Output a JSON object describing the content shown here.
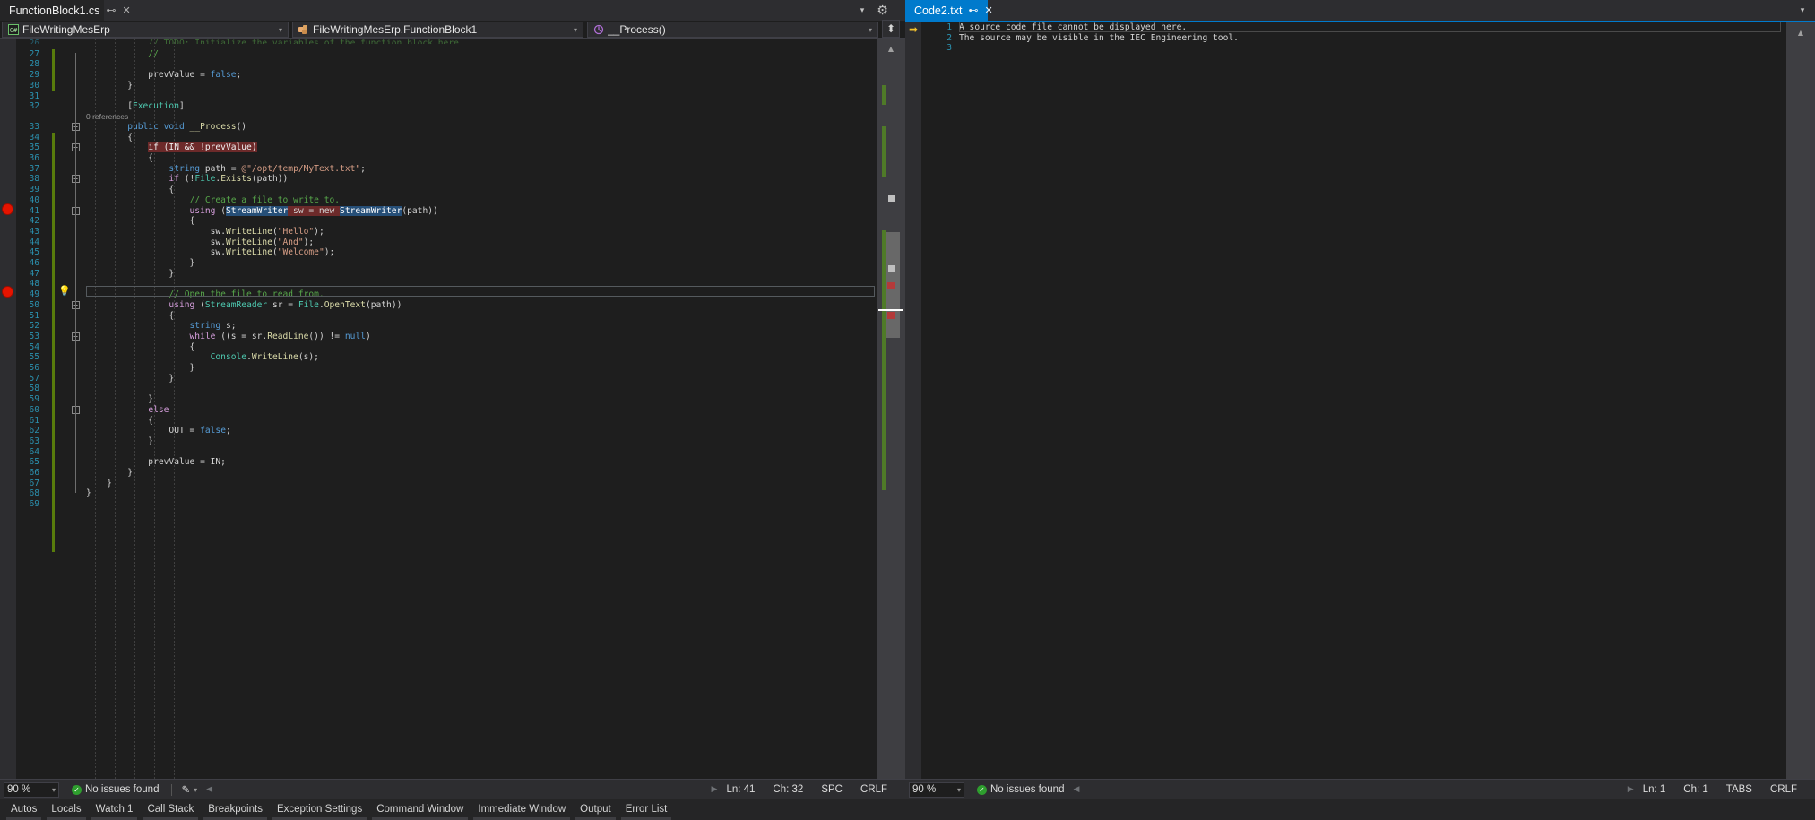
{
  "window": {
    "background": "#1e1e1e",
    "accent": "#007acc"
  },
  "left_pane": {
    "tab": {
      "label": "FunctionBlock1.cs",
      "pin_icon": "pin-icon",
      "close_icon": "close-icon",
      "pin_glyph": "⊷",
      "close_glyph": "✕"
    },
    "gear_glyph": "⚙",
    "chevron_glyph": "▾",
    "navbar": {
      "project_combo": {
        "icon": "csharp-file-icon",
        "value": "FileWritingMesErp",
        "arrow": "▾"
      },
      "type_combo": {
        "icon": "class-icon",
        "value": "FileWritingMesErp.FunctionBlock1",
        "arrow": "▾"
      },
      "member_combo": {
        "icon": "method-icon",
        "value": "__Process()",
        "arrow": "▾"
      },
      "split_button": {
        "icon": "split-window-icon",
        "glyph": "⬍"
      }
    },
    "editor": {
      "first_visible_line": 26,
      "current_line": 41,
      "breakpoint_lines": [
        35,
        41
      ],
      "lightbulb_line": 41,
      "lines": [
        {
          "n": 26,
          "clipped": true,
          "tokens": [
            {
              "t": "            // TODO: Initialize the variables of the function block here",
              "c": "cmt"
            }
          ]
        },
        {
          "n": 27,
          "tokens": [
            {
              "t": "            //",
              "c": "cmt"
            }
          ]
        },
        {
          "n": 28,
          "tokens": []
        },
        {
          "n": 29,
          "tokens": [
            {
              "t": "            prevValue ",
              "c": "id"
            },
            {
              "t": "= ",
              "c": "pun"
            },
            {
              "t": "false",
              "c": "kw"
            },
            {
              "t": ";",
              "c": "pun"
            }
          ]
        },
        {
          "n": 30,
          "tokens": [
            {
              "t": "        }",
              "c": "pun"
            }
          ]
        },
        {
          "n": 31,
          "tokens": []
        },
        {
          "n": 32,
          "tokens": [
            {
              "t": "        [",
              "c": "pun"
            },
            {
              "t": "Execution",
              "c": "attr"
            },
            {
              "t": "]",
              "c": "pun"
            }
          ]
        },
        {
          "n": 33,
          "refs": "0 references",
          "tokens": [
            {
              "t": "        ",
              "c": "pun"
            },
            {
              "t": "public ",
              "c": "kw"
            },
            {
              "t": "void ",
              "c": "kw"
            },
            {
              "t": "__Process",
              "c": "mth"
            },
            {
              "t": "()",
              "c": "pun"
            }
          ]
        },
        {
          "n": 34,
          "tokens": [
            {
              "t": "        {",
              "c": "pun"
            }
          ]
        },
        {
          "n": 35,
          "highlight": "breakpoint",
          "tokens": [
            {
              "t": "            ",
              "c": "pun"
            },
            {
              "t": "if (IN && !prevValue)",
              "c": "hl-bp"
            }
          ]
        },
        {
          "n": 36,
          "tokens": [
            {
              "t": "            {",
              "c": "pun"
            }
          ]
        },
        {
          "n": 37,
          "tokens": [
            {
              "t": "                ",
              "c": "pun"
            },
            {
              "t": "string ",
              "c": "kw"
            },
            {
              "t": "path ",
              "c": "id"
            },
            {
              "t": "= ",
              "c": "pun"
            },
            {
              "t": "@\"/opt/temp/MyText.txt\"",
              "c": "str"
            },
            {
              "t": ";",
              "c": "pun"
            }
          ]
        },
        {
          "n": 38,
          "tokens": [
            {
              "t": "                ",
              "c": "pun"
            },
            {
              "t": "if ",
              "c": "kwc"
            },
            {
              "t": "(!",
              "c": "pun"
            },
            {
              "t": "File",
              "c": "typ"
            },
            {
              "t": ".",
              "c": "pun"
            },
            {
              "t": "Exists",
              "c": "mth"
            },
            {
              "t": "(path))",
              "c": "pun"
            }
          ]
        },
        {
          "n": 39,
          "tokens": [
            {
              "t": "                {",
              "c": "pun"
            }
          ]
        },
        {
          "n": 40,
          "tokens": [
            {
              "t": "                    // Create a file to write to.",
              "c": "cmt"
            }
          ]
        },
        {
          "n": 41,
          "highlight": "current",
          "tokens": [
            {
              "t": "                    ",
              "c": "pun"
            },
            {
              "t": "using ",
              "c": "kwc"
            },
            {
              "t": "(",
              "c": "pun"
            },
            {
              "t": "StreamWriter",
              "c": "hl-sel"
            },
            {
              "t": " sw = new ",
              "c": "hl-word"
            },
            {
              "t": "StreamWriter",
              "c": "hl-sel"
            },
            {
              "t": "(path))",
              "c": "pun"
            }
          ]
        },
        {
          "n": 42,
          "tokens": [
            {
              "t": "                    {",
              "c": "pun"
            }
          ]
        },
        {
          "n": 43,
          "tokens": [
            {
              "t": "                        sw",
              "c": "id"
            },
            {
              "t": ".",
              "c": "pun"
            },
            {
              "t": "WriteLine",
              "c": "mth"
            },
            {
              "t": "(",
              "c": "pun"
            },
            {
              "t": "\"Hello\"",
              "c": "str"
            },
            {
              "t": ");",
              "c": "pun"
            }
          ]
        },
        {
          "n": 44,
          "tokens": [
            {
              "t": "                        sw",
              "c": "id"
            },
            {
              "t": ".",
              "c": "pun"
            },
            {
              "t": "WriteLine",
              "c": "mth"
            },
            {
              "t": "(",
              "c": "pun"
            },
            {
              "t": "\"And\"",
              "c": "str"
            },
            {
              "t": ");",
              "c": "pun"
            }
          ]
        },
        {
          "n": 45,
          "tokens": [
            {
              "t": "                        sw",
              "c": "id"
            },
            {
              "t": ".",
              "c": "pun"
            },
            {
              "t": "WriteLine",
              "c": "mth"
            },
            {
              "t": "(",
              "c": "pun"
            },
            {
              "t": "\"Welcome\"",
              "c": "str"
            },
            {
              "t": ");",
              "c": "pun"
            }
          ]
        },
        {
          "n": 46,
          "tokens": [
            {
              "t": "                    }",
              "c": "pun"
            }
          ]
        },
        {
          "n": 47,
          "tokens": [
            {
              "t": "                }",
              "c": "pun"
            }
          ]
        },
        {
          "n": 48,
          "tokens": []
        },
        {
          "n": 49,
          "tokens": [
            {
              "t": "                // Open the file to read from.",
              "c": "cmt"
            }
          ]
        },
        {
          "n": 50,
          "tokens": [
            {
              "t": "                ",
              "c": "pun"
            },
            {
              "t": "using ",
              "c": "kwc"
            },
            {
              "t": "(",
              "c": "pun"
            },
            {
              "t": "StreamReader",
              "c": "typ"
            },
            {
              "t": " sr = ",
              "c": "id"
            },
            {
              "t": "File",
              "c": "typ"
            },
            {
              "t": ".",
              "c": "pun"
            },
            {
              "t": "OpenText",
              "c": "mth"
            },
            {
              "t": "(path))",
              "c": "pun"
            }
          ]
        },
        {
          "n": 51,
          "tokens": [
            {
              "t": "                {",
              "c": "pun"
            }
          ]
        },
        {
          "n": 52,
          "tokens": [
            {
              "t": "                    ",
              "c": "pun"
            },
            {
              "t": "string ",
              "c": "kw"
            },
            {
              "t": "s",
              "c": "id"
            },
            {
              "t": ";",
              "c": "pun"
            }
          ]
        },
        {
          "n": 53,
          "tokens": [
            {
              "t": "                    ",
              "c": "pun"
            },
            {
              "t": "while ",
              "c": "kwc"
            },
            {
              "t": "((s = sr",
              "c": "id"
            },
            {
              "t": ".",
              "c": "pun"
            },
            {
              "t": "ReadLine",
              "c": "mth"
            },
            {
              "t": "()) != ",
              "c": "pun"
            },
            {
              "t": "null",
              "c": "kw"
            },
            {
              "t": ")",
              "c": "pun"
            }
          ]
        },
        {
          "n": 54,
          "tokens": [
            {
              "t": "                    {",
              "c": "pun"
            }
          ]
        },
        {
          "n": 55,
          "tokens": [
            {
              "t": "                        ",
              "c": "pun"
            },
            {
              "t": "Console",
              "c": "typ"
            },
            {
              "t": ".",
              "c": "pun"
            },
            {
              "t": "WriteLine",
              "c": "mth"
            },
            {
              "t": "(s);",
              "c": "pun"
            }
          ]
        },
        {
          "n": 56,
          "tokens": [
            {
              "t": "                    }",
              "c": "pun"
            }
          ]
        },
        {
          "n": 57,
          "tokens": [
            {
              "t": "                }",
              "c": "pun"
            }
          ]
        },
        {
          "n": 58,
          "tokens": []
        },
        {
          "n": 59,
          "tokens": [
            {
              "t": "            }",
              "c": "pun"
            }
          ]
        },
        {
          "n": 60,
          "tokens": [
            {
              "t": "            ",
              "c": "pun"
            },
            {
              "t": "else",
              "c": "kwc"
            }
          ]
        },
        {
          "n": 61,
          "tokens": [
            {
              "t": "            {",
              "c": "pun"
            }
          ]
        },
        {
          "n": 62,
          "tokens": [
            {
              "t": "                OUT ",
              "c": "id"
            },
            {
              "t": "= ",
              "c": "pun"
            },
            {
              "t": "false",
              "c": "kw"
            },
            {
              "t": ";",
              "c": "pun"
            }
          ]
        },
        {
          "n": 63,
          "tokens": [
            {
              "t": "            }",
              "c": "pun"
            }
          ]
        },
        {
          "n": 64,
          "tokens": []
        },
        {
          "n": 65,
          "tokens": [
            {
              "t": "            prevValue ",
              "c": "id"
            },
            {
              "t": "= IN;",
              "c": "pun"
            }
          ]
        },
        {
          "n": 66,
          "tokens": [
            {
              "t": "        }",
              "c": "pun"
            }
          ]
        },
        {
          "n": 67,
          "tokens": [
            {
              "t": "    }",
              "c": "pun"
            }
          ]
        },
        {
          "n": 68,
          "tokens": [
            {
              "t": "}",
              "c": "pun"
            }
          ]
        },
        {
          "n": 69,
          "tokens": []
        }
      ]
    },
    "statusbar": {
      "zoom": "90 %",
      "zoom_arrow": "▾",
      "issues_icon": "check-circle-icon",
      "issues": "No issues found",
      "pen_icon": "pen-icon",
      "pen_glyph": "✎",
      "pen_arrow": "▾",
      "scroll_left_glyph": "◀",
      "scroll_right_glyph": "▶",
      "line": "Ln: 41",
      "col": "Ch: 32",
      "indent": "SPC",
      "eol": "CRLF"
    }
  },
  "right_pane": {
    "tab": {
      "label": "Code2.txt",
      "active": true,
      "pin_glyph": "⊷",
      "close_glyph": "✕"
    },
    "gear_glyph": "▾",
    "editor": {
      "marker_line": 1,
      "marker_icon": "bookmark-arrow-icon",
      "marker_glyph": "➡",
      "lines": [
        {
          "n": 1,
          "text": "A source code file cannot be displayed here."
        },
        {
          "n": 2,
          "text": "The source may be visible in the IEC Engineering tool."
        },
        {
          "n": 3,
          "text": ""
        }
      ]
    },
    "statusbar": {
      "zoom": "90 %",
      "zoom_arrow": "▾",
      "issues_icon": "check-circle-icon",
      "issues": "No issues found",
      "scroll_left_glyph": "◀",
      "scroll_right_glyph": "▶",
      "line": "Ln: 1",
      "col": "Ch: 1",
      "indent": "TABS",
      "eol": "CRLF"
    },
    "split_button_glyph": "⬍",
    "scroll_up_glyph": "▲"
  },
  "dock_tabs": [
    "Autos",
    "Locals",
    "Watch 1",
    "Call Stack",
    "Breakpoints",
    "Exception Settings",
    "Command Window",
    "Immediate Window",
    "Output",
    "Error List"
  ]
}
